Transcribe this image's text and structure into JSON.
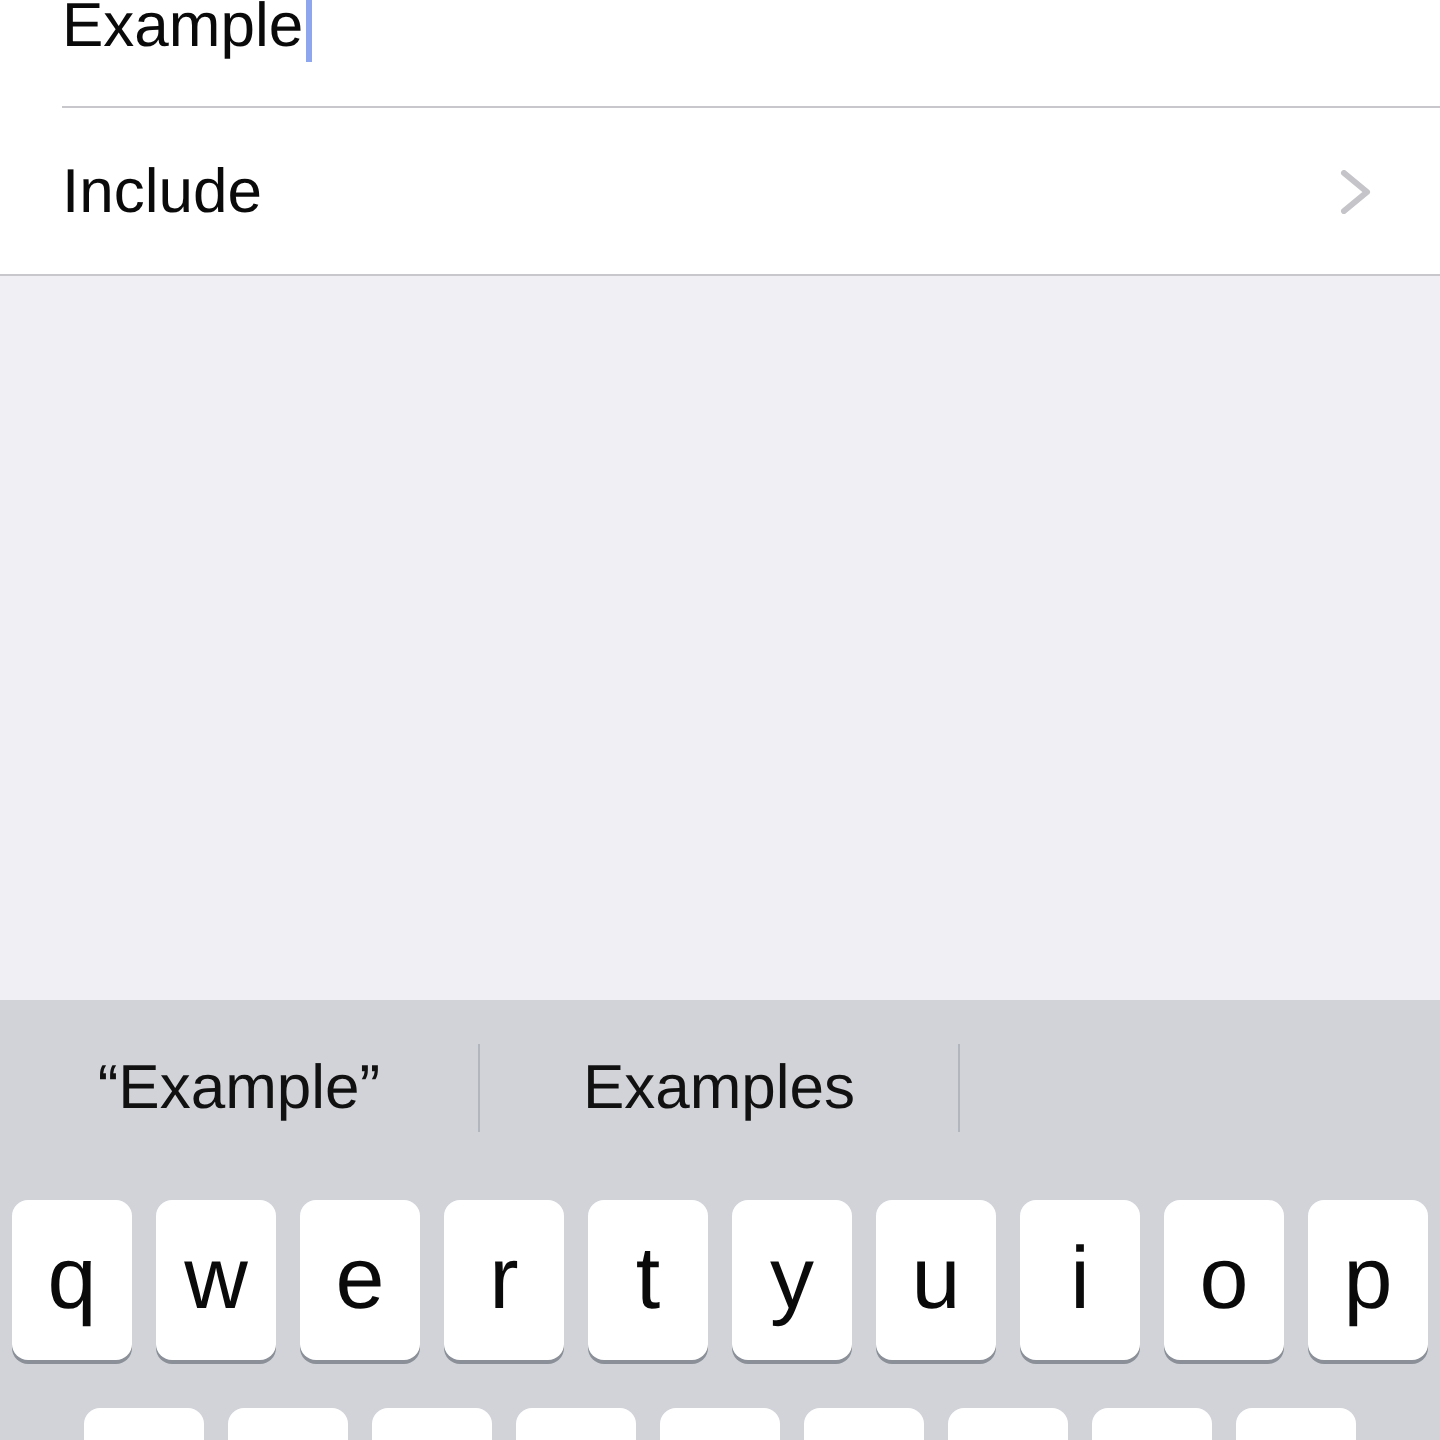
{
  "form": {
    "field": {
      "value": "Example",
      "focused": true
    },
    "rows": [
      {
        "label": "Include"
      }
    ]
  },
  "keyboard": {
    "suggestions": [
      {
        "text": "“Example”"
      },
      {
        "text": "Examples"
      }
    ],
    "rows": [
      {
        "keys": [
          {
            "kind": "letter",
            "label": "q"
          },
          {
            "kind": "letter",
            "label": "w"
          },
          {
            "kind": "letter",
            "label": "e"
          },
          {
            "kind": "letter",
            "label": "r"
          },
          {
            "kind": "letter",
            "label": "t"
          },
          {
            "kind": "letter",
            "label": "y"
          },
          {
            "kind": "letter",
            "label": "u"
          },
          {
            "kind": "letter",
            "label": "i"
          },
          {
            "kind": "letter",
            "label": "o"
          },
          {
            "kind": "letter",
            "label": "p"
          }
        ]
      },
      {
        "keys": [
          {
            "kind": "blank"
          },
          {
            "kind": "blank"
          },
          {
            "kind": "blank"
          },
          {
            "kind": "blank"
          },
          {
            "kind": "blank"
          },
          {
            "kind": "blank"
          },
          {
            "kind": "blank"
          },
          {
            "kind": "blank"
          },
          {
            "kind": "blank"
          }
        ]
      }
    ]
  }
}
